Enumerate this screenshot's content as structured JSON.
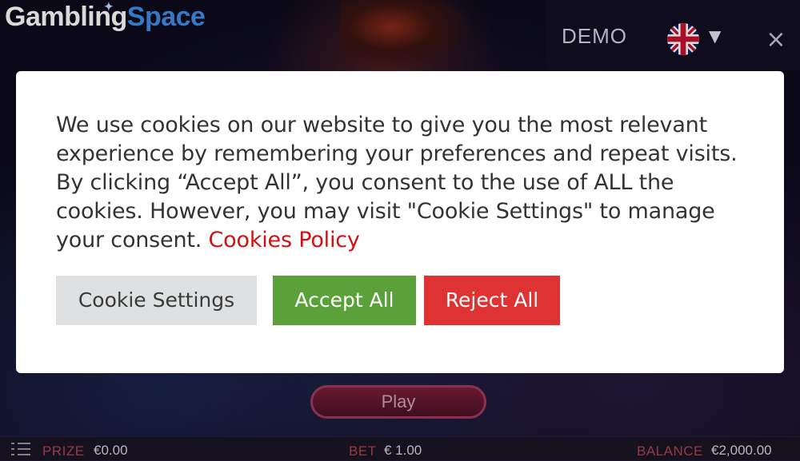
{
  "brand": {
    "word1": "Gambling",
    "word2": "Space"
  },
  "header": {
    "mode_label": "DEMO",
    "language_caret": "▼",
    "close_glyph": "×"
  },
  "game": {
    "play_label": "Play"
  },
  "status_bar": {
    "prize_label": "PRIZE",
    "prize_value": "€0.00",
    "bet_label": "BET",
    "bet_value": "€ 1.00",
    "balance_label": "BALANCE",
    "balance_value": "€2,000.00"
  },
  "cookie_dialog": {
    "message": "We use cookies on our website to give you the most relevant experience by remembering your preferences and repeat visits. By clicking “Accept All”, you consent to the use of ALL the cookies. However, you may visit \"Cookie Settings\" to manage your consent.",
    "policy_link": "Cookies Policy",
    "settings_label": "Cookie Settings",
    "accept_label": "Accept All",
    "reject_label": "Reject All"
  },
  "icons": {
    "star": "star-icon",
    "flag": "uk-flag-icon",
    "caret": "chevron-down-icon",
    "close": "close-icon",
    "menu": "menu-list-icon"
  },
  "colors": {
    "brand_blue": "#3f8ee8",
    "accept_green": "#5aa13a",
    "reject_red": "#df3232",
    "policy_link_red": "#d40f0f",
    "status_label_red": "#b4434f"
  }
}
